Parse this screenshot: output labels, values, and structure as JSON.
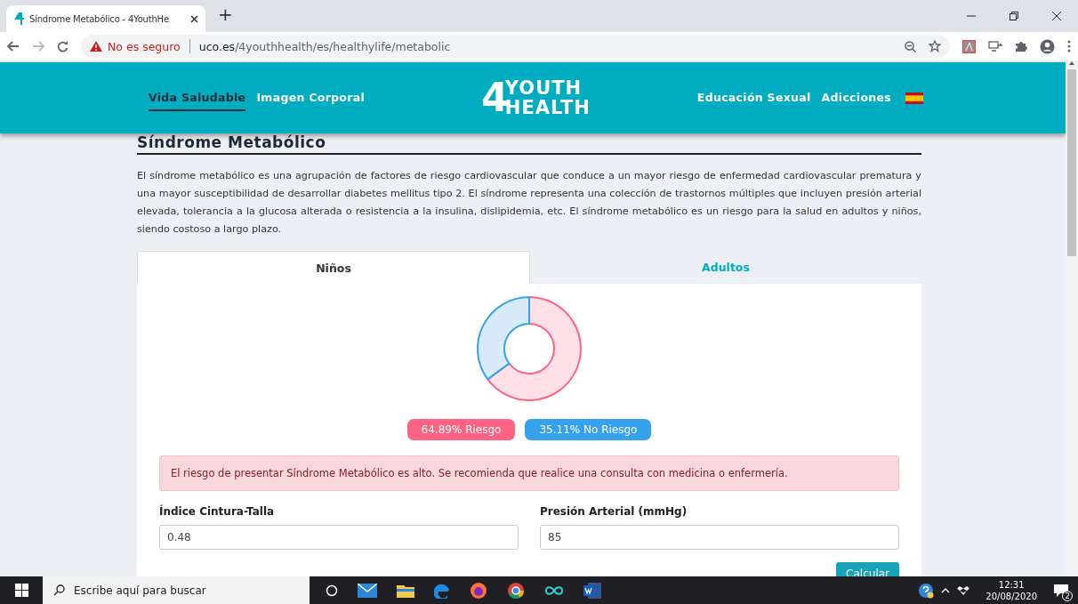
{
  "browser": {
    "tab_title": "Síndrome Metabólico - 4YouthHe",
    "new_tab": "+",
    "security": "No es seguro",
    "url_host": "uco.es",
    "url_path": "/4youthhealth/es/healthylife/metabolic"
  },
  "header": {
    "nav_left": [
      {
        "label": "Vida Saludable",
        "selected": true
      },
      {
        "label": "Imagen Corporal",
        "selected": false
      }
    ],
    "logo": {
      "digit": "4",
      "line1": "YOUTH",
      "line2": "HEALTH"
    },
    "nav_right": [
      {
        "label": "Educación Sexual",
        "selected": false
      },
      {
        "label": "Adicciones",
        "selected": false
      }
    ]
  },
  "page": {
    "title": "Síndrome Metabólico",
    "intro": "El síndrome metabólico es una agrupación de factores de riesgo cardiovascular que conduce a un mayor riesgo de enfermedad cardiovascular prematura y una mayor susceptibilidad de desarrollar diabetes mellitus tipo 2. El síndrome representa una colección de trastornos múltiples que incluyen presión arterial elevada, tolerancia a la glucosa alterada o resistencia a la insulina, dislipidemia, etc. El síndrome metabólico es un riesgo para la salud en adultos y niños, siendo costoso a largo plazo.",
    "tabs": [
      {
        "label": "Niños",
        "selected": true
      },
      {
        "label": "Adultos",
        "selected": false
      }
    ],
    "chart_data": {
      "type": "donut",
      "values": [
        64.89,
        35.11
      ]
    },
    "legend": [
      {
        "label": "64.89% Riesgo",
        "color": "#ff6384"
      },
      {
        "label": "35.11% No Riesgo",
        "color": "#36a2eb"
      }
    ],
    "alert": "El riesgo de presentar Síndrome Metabólico es alto. Se recomienda que realice una consulta con medicina o enfermería.",
    "fields": [
      {
        "label": "Índice Cintura-Talla",
        "value": "0.48"
      },
      {
        "label": "Presión Arterial (mmHg)",
        "value": "85"
      }
    ],
    "submit": "Calcular"
  },
  "taskbar": {
    "search_placeholder": "Escribe aquí para buscar",
    "time": "12:31",
    "date": "20/08/2020",
    "notifications": "2"
  }
}
